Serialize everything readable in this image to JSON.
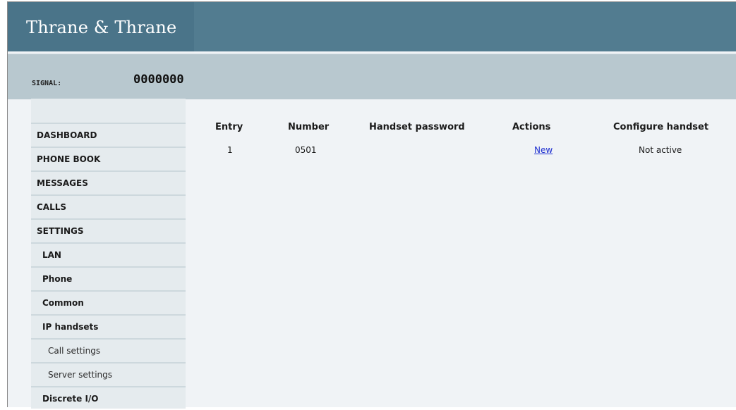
{
  "brand": "Thrane & Thrane",
  "signal": {
    "label": "SIGNAL:",
    "value": "0000000"
  },
  "sidebar": {
    "items": [
      {
        "label": "DASHBOARD"
      },
      {
        "label": "PHONE BOOK"
      },
      {
        "label": "MESSAGES"
      },
      {
        "label": "CALLS"
      },
      {
        "label": "SETTINGS"
      },
      {
        "label": "LAN"
      },
      {
        "label": "Phone"
      },
      {
        "label": "Common"
      },
      {
        "label": "IP handsets"
      },
      {
        "label": "Call settings"
      },
      {
        "label": "Server settings"
      },
      {
        "label": "Discrete I/O"
      }
    ]
  },
  "table": {
    "columns": [
      "Entry",
      "Number",
      "Handset password",
      "Actions",
      "Configure handset"
    ],
    "rows": [
      {
        "entry": "1",
        "number": "0501",
        "password": "",
        "action": "New",
        "status": "Not active"
      }
    ]
  },
  "colors": {
    "header": "#527c90",
    "signal_bar": "#b8c8cf",
    "sidebar": "#e5ebee",
    "content": "#f0f3f6",
    "link": "#1e2fd0"
  }
}
